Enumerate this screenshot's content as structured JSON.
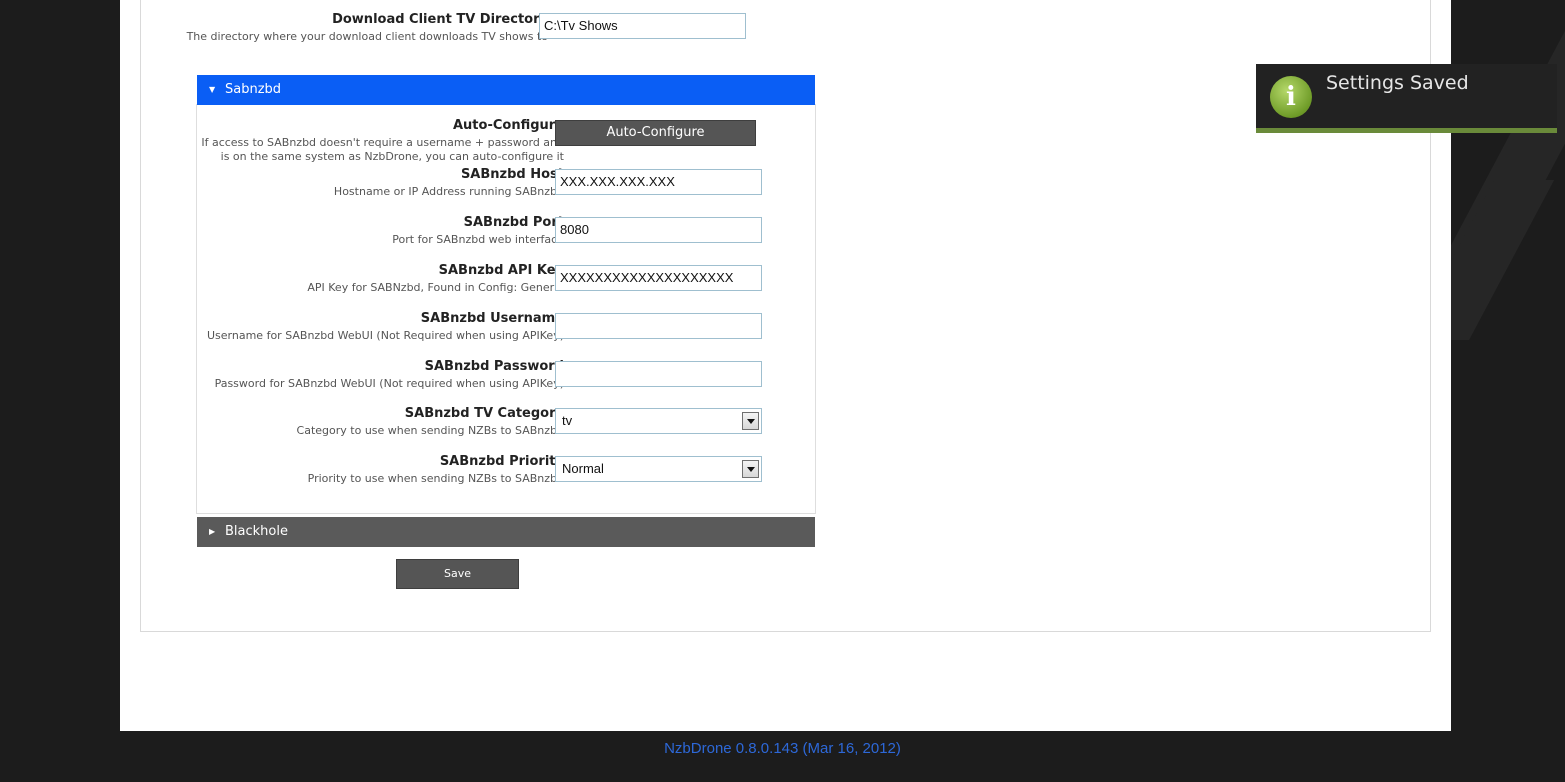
{
  "download_dir": {
    "label": "Download Client TV Directory",
    "description": "The directory where your download client downloads TV shows to",
    "value": "C:\\Tv Shows"
  },
  "sabnzbd_section": {
    "title": "Sabnzbd",
    "header_color": "#0a5ef5",
    "auto_configure": {
      "label": "Auto-Configure",
      "description_line1": "If access to SABnzbd doesn't require a username + password and",
      "description_line2": "is on the same system as NzbDrone, you can auto-configure it",
      "button_label": "Auto-Configure"
    },
    "host": {
      "label": "SABnzbd Host",
      "description": "Hostname or IP Address running SABnzbd",
      "value": "XXX.XXX.XXX.XXX"
    },
    "port": {
      "label": "SABnzbd Port",
      "description": "Port for SABnzbd web interface",
      "value": "8080"
    },
    "api_key": {
      "label": "SABnzbd API Key",
      "description": "API Key for SABNzbd, Found in Config: General",
      "value": "XXXXXXXXXXXXXXXXXXXX"
    },
    "username": {
      "label": "SABnzbd Username",
      "description": "Username for SABnzbd WebUI (Not Required when using APIKey)",
      "value": ""
    },
    "password": {
      "label": "SABnzbd Password",
      "description": "Password for SABnzbd WebUI (Not required when using APIKey)",
      "value": ""
    },
    "tv_category": {
      "label": "SABnzbd TV Category",
      "description": "Category to use when sending NZBs to SABnzbd",
      "value": "tv"
    },
    "priority": {
      "label": "SABnzbd Priority",
      "description": "Priority to use when sending NZBs to SABnzbd",
      "value": "Normal"
    }
  },
  "blackhole_section": {
    "title": "Blackhole",
    "header_color": "#5a5a5a"
  },
  "save_button": "Save",
  "toast": {
    "message": "Settings Saved",
    "icon": "info-icon"
  },
  "footer": {
    "version_text": "NzbDrone 0.8.0.143 (Mar 16, 2012)"
  }
}
